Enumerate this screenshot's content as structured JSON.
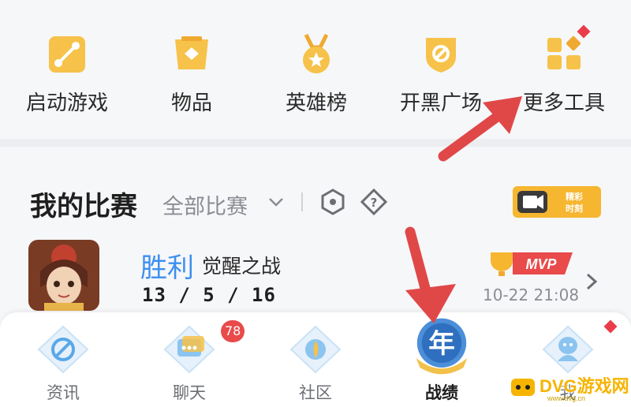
{
  "tools": [
    {
      "label": "启动游戏",
      "icon": "gamepad-launch-icon"
    },
    {
      "label": "物品",
      "icon": "item-bag-icon"
    },
    {
      "label": "英雄榜",
      "icon": "medal-icon"
    },
    {
      "label": "开黑广场",
      "icon": "shield-plaza-icon"
    },
    {
      "label": "更多工具",
      "icon": "grid-more-icon"
    }
  ],
  "match": {
    "title": "我的比赛",
    "filter": "全部比赛",
    "highlight_label": "精彩时刻",
    "game": {
      "result": "胜利",
      "mode": "觉醒之战",
      "kda": "13 / 5 / 16",
      "badge": "MVP",
      "time": "10-22 21:08"
    }
  },
  "nav": [
    {
      "label": "资讯",
      "icon": "news-icon"
    },
    {
      "label": "聊天",
      "icon": "chat-icon",
      "badge": "78"
    },
    {
      "label": "社区",
      "icon": "community-icon"
    },
    {
      "label": "战绩",
      "icon": "record-icon",
      "active": true,
      "emblem": "年"
    },
    {
      "label": "我",
      "icon": "profile-icon"
    }
  ],
  "watermark": {
    "main": "DVG游戏网",
    "sub": "www.dvg.cn"
  },
  "colors": {
    "accent": "#f6b630",
    "win": "#3d8ff0",
    "badge": "#e94a4a",
    "arrow": "#e04848"
  }
}
